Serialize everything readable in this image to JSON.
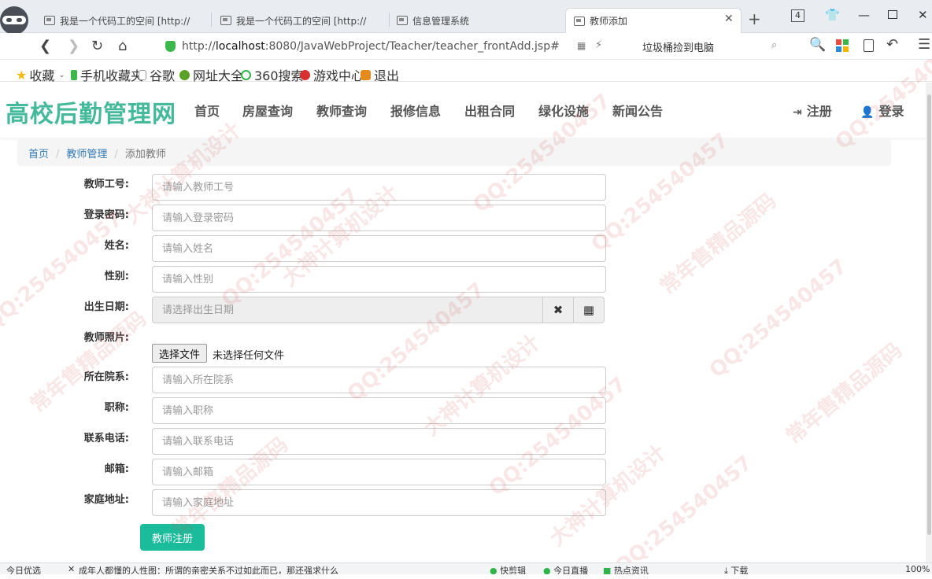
{
  "browser": {
    "tabs": [
      {
        "title": "我是一个代码工的空间 [http://"
      },
      {
        "title": "我是一个代码工的空间 [http://"
      },
      {
        "title": "信息管理系统"
      },
      {
        "title": "教师添加"
      }
    ],
    "tab_count": "4",
    "url_host": "localhost",
    "url_rest": ":8080/JavaWebProject/Teacher/teacher_frontAdd.jsp#",
    "url_prefix": "http://",
    "search_text": "垃圾桶捡到电脑",
    "bookmarks": [
      "收藏",
      "手机收藏夹",
      "谷歌",
      "网址大全",
      "360搜索",
      "游戏中心",
      "退出"
    ]
  },
  "site": {
    "brand": "高校后勤管理网",
    "nav": [
      "首页",
      "房屋查询",
      "教师查询",
      "报修信息",
      "出租合同",
      "绿化设施",
      "新闻公告"
    ],
    "register": "注册",
    "login": "登录"
  },
  "breadcrumb": {
    "home": "首页",
    "section": "教师管理",
    "current": "添加教师"
  },
  "form": {
    "teacher_no_label": "教师工号:",
    "teacher_no_placeholder": "请输入教师工号",
    "password_label": "登录密码:",
    "password_placeholder": "请输入登录密码",
    "name_label": "姓名:",
    "name_placeholder": "请输入姓名",
    "gender_label": "性别:",
    "gender_placeholder": "请输入性别",
    "birth_label": "出生日期:",
    "birth_placeholder": "请选择出生日期",
    "photo_label": "教师照片:",
    "file_button": "选择文件",
    "file_none": "未选择任何文件",
    "college_label": "所在院系:",
    "college_placeholder": "请输入所在院系",
    "title_label": "职称:",
    "title_placeholder": "请输入职称",
    "phone_label": "联系电话:",
    "phone_placeholder": "请输入联系电话",
    "email_label": "邮箱:",
    "email_placeholder": "请输入邮箱",
    "address_label": "家庭地址:",
    "address_placeholder": "请输入家庭地址",
    "submit": "教师注册"
  },
  "statusbar": {
    "left": "今日优选",
    "news": "成年人都懂的人性图：所谓的亲密关系不过如此而已，那还强求什么",
    "items": [
      "快剪辑",
      "今日直播",
      "热点资讯",
      "下载"
    ],
    "zoom": "100%"
  },
  "watermark": {
    "qq": "QQ:254540457",
    "a": "常年售精品源码",
    "b": "大神计算机设计"
  }
}
